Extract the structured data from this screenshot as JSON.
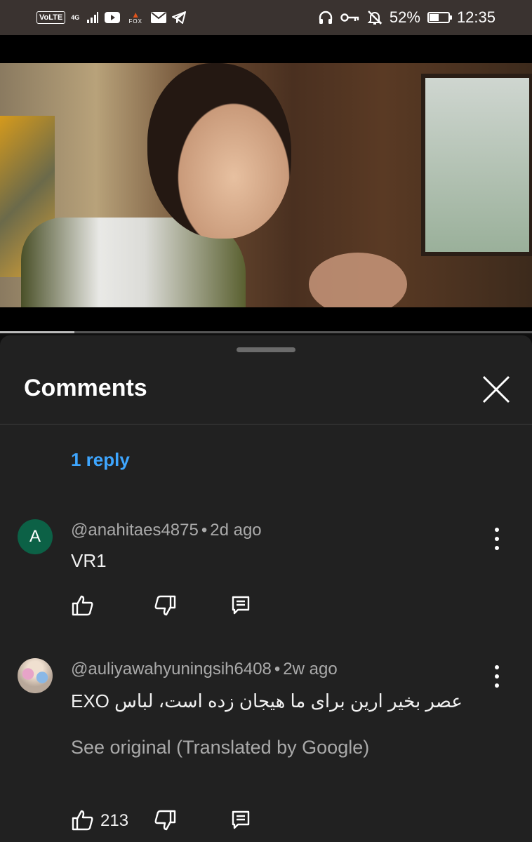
{
  "status_bar": {
    "volte": "VoLTE",
    "network": "4G",
    "app_label": "FOX",
    "battery": "52%",
    "battery_level": 0.52,
    "time": "12:35"
  },
  "video": {
    "progress": 0.14
  },
  "comments_panel": {
    "title": "Comments",
    "reply_link": "1 reply",
    "comments": [
      {
        "avatar_letter": "A",
        "avatar_color": "#0c6146",
        "author": "@anahitaes4875",
        "separator": "•",
        "age": "2d ago",
        "text": "VR1"
      },
      {
        "author": "@auliyawahyuningsih6408",
        "separator": "•",
        "age": "2w ago",
        "text": "عصر بخیر ارین برای ما هیجان زده است، لباس EXO",
        "see_original": "See original (Translated by Google)",
        "like_count": "213"
      }
    ]
  },
  "colors": {
    "accent_link": "#3ea6ff",
    "sheet_bg": "#212121",
    "status_bar_bg": "#3a3330"
  }
}
